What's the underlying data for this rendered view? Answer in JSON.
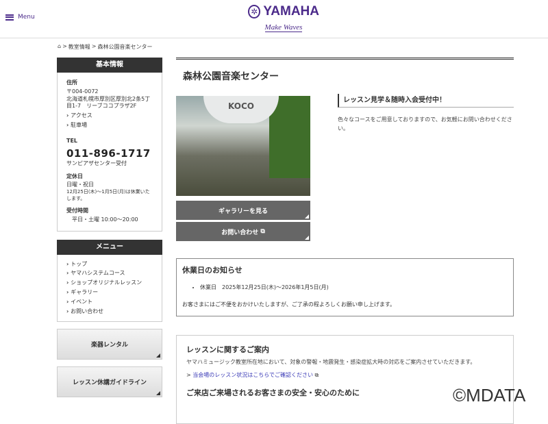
{
  "header": {
    "menu_label": "Menu",
    "logo_name": "YAMAHA",
    "logo_tagline": "Make Waves"
  },
  "breadcrumb": [
    "教室情報",
    "森林公園音楽センター"
  ],
  "sidebar": {
    "info_title": "基本情報",
    "address_label": "住所",
    "zip": "〒004-0072",
    "address": "北海道札幌市厚別区厚別北2条5丁目1-7　リーブココプラザ2F",
    "access": "アクセス",
    "parking": "駐車場",
    "tel_label": "TEL",
    "tel": "011-896-1717",
    "tel_note": "サンピアザセンター受付",
    "closed_label": "定休日",
    "closed": "日曜・祝日",
    "closed_note": "12月25日(木)～1月5日(月)は休業いたします。",
    "hours_label": "受付時間",
    "hours": "平日・土曜 10:00～20:00",
    "menu_title": "メニュー",
    "menu_items": [
      "トップ",
      "ヤマハシステムコース",
      "ショップオリジナルレッスン",
      "ギャラリー",
      "イベント",
      "お問い合わせ"
    ],
    "buttons": [
      "楽器レンタル",
      "レッスン休講ガイドライン"
    ]
  },
  "main": {
    "title": "森林公園音楽センター",
    "photo_sign": "KOCO",
    "gallery_button": "ギャラリーを見る",
    "contact_button": "お問い合わせ",
    "announce_title": "レッスン見学＆随時入会受付中！",
    "announce_text": "色々なコースをご用意しておりますので、お気軽にお問い合わせください。",
    "notice_title": "休業日のお知らせ",
    "notice_item": "休業日　2025年12月25日(木)～2026年1月5日(月)",
    "notice_text": "お客さまにはご不便をおかけいたしますが、ご了承の程よろしくお願い申し上げます。",
    "lesson_title": "レッスンに関するご案内",
    "lesson_text": "ヤマハミュージック教室所在地において、対象の警報・地震発生・感染症拡大時の対応をご案内させていただきます。",
    "lesson_link": "当会場のレッスン状況はこちらでご確認ください",
    "safety_title": "ご来店ご来場されるお客さまの安全・安心のために"
  },
  "watermark": "©MDATA"
}
